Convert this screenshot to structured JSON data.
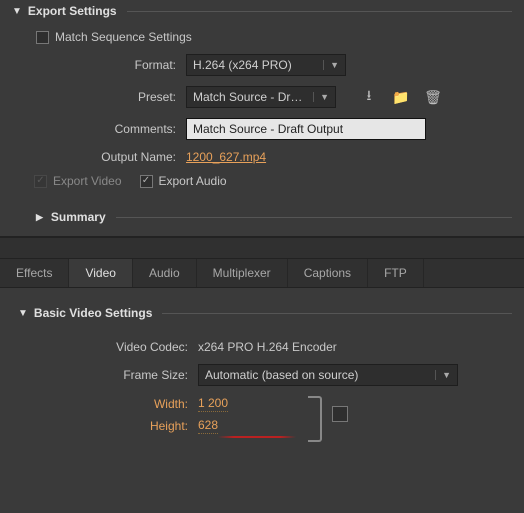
{
  "export": {
    "title": "Export Settings",
    "match_sequence_label": "Match Sequence Settings",
    "format_label": "Format:",
    "format_value": "H.264 (x264 PRO)",
    "preset_label": "Preset:",
    "preset_value": "Match Source - Dr…",
    "comments_label": "Comments:",
    "comments_value": "Match Source - Draft Output",
    "output_name_label": "Output Name:",
    "output_name_value": "1200_627.mp4",
    "export_video_label": "Export Video",
    "export_audio_label": "Export Audio",
    "summary_label": "Summary"
  },
  "tabs": {
    "effects": "Effects",
    "video": "Video",
    "audio": "Audio",
    "multiplexer": "Multiplexer",
    "captions": "Captions",
    "ftp": "FTP"
  },
  "basic": {
    "title": "Basic Video Settings",
    "codec_label": "Video Codec:",
    "codec_value": "x264 PRO H.264 Encoder",
    "frame_size_label": "Frame Size:",
    "frame_size_value": "Automatic (based on source)",
    "width_label": "Width:",
    "width_value": "1 200",
    "height_label": "Height:",
    "height_value": "628"
  },
  "icons": {
    "save": "⭳",
    "import": "📁",
    "trash": "🗑"
  }
}
